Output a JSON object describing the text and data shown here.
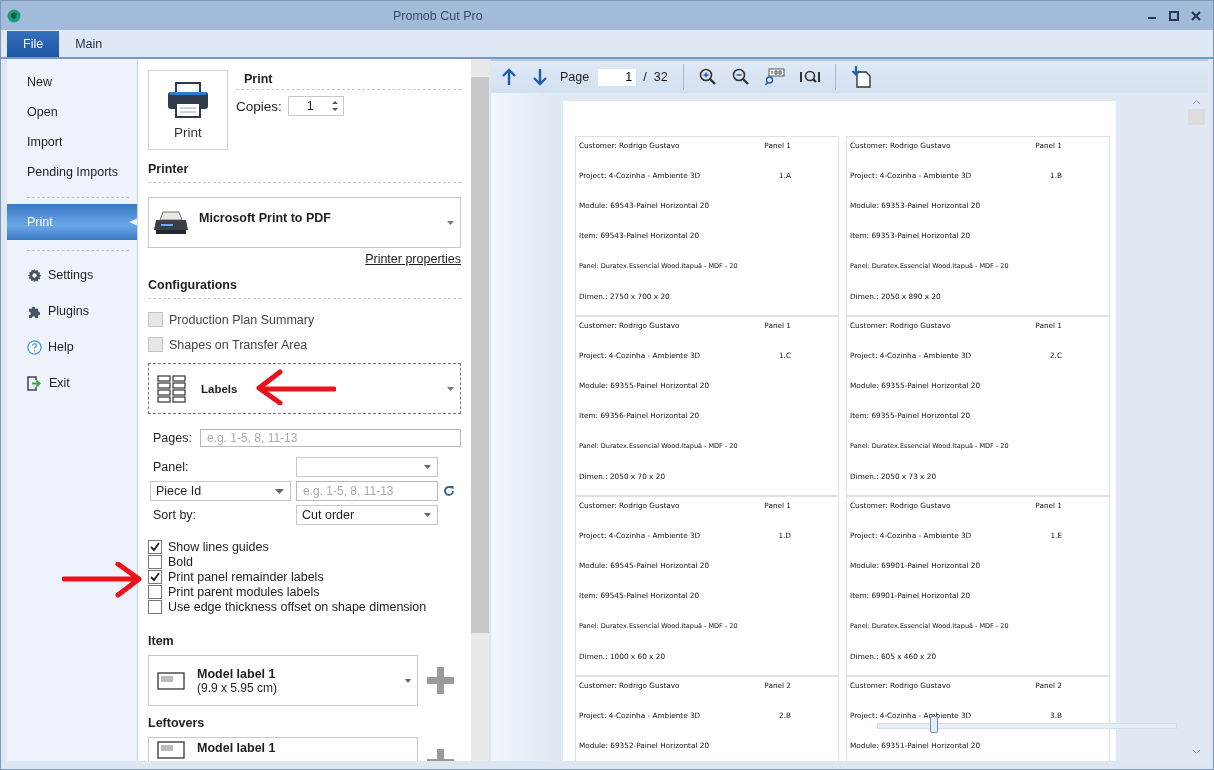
{
  "window": {
    "title": "Promob Cut Pro"
  },
  "tabs": [
    {
      "label": "File",
      "selected": true
    },
    {
      "label": "Main",
      "selected": false
    }
  ],
  "nav": {
    "items": [
      {
        "label": "New",
        "selected": false
      },
      {
        "label": "Open",
        "selected": false
      },
      {
        "label": "Import",
        "selected": false
      },
      {
        "label": "Pending Imports",
        "selected": false
      },
      {
        "label": "Print",
        "selected": true
      },
      {
        "label": "Settings",
        "selected": false
      },
      {
        "label": "Plugins",
        "selected": false
      },
      {
        "label": "Help",
        "selected": false
      },
      {
        "label": "Exit",
        "selected": false
      }
    ]
  },
  "print": {
    "button": "Print",
    "heading": "Print",
    "copies_label": "Copies:",
    "copies": "1"
  },
  "printer": {
    "heading": "Printer",
    "name": "Microsoft Print to PDF",
    "link": "Printer properties"
  },
  "configurations": {
    "heading": "Configurations",
    "options": [
      {
        "label": "Production Plan Summary",
        "checked": false,
        "disabled": true
      },
      {
        "label": "Shapes on Transfer Area",
        "checked": false,
        "disabled": true
      }
    ],
    "report": "Labels",
    "pages_label": "Pages:",
    "pages_placeholder": "e.g. 1-5, 8, 11-13",
    "panel_label": "Panel:",
    "filter": "Piece Id",
    "filter_placeholder": "e.g. 1-5, 8, 11-13",
    "sort_label": "Sort by:",
    "sort": "Cut order",
    "checks": [
      {
        "label": "Show lines guides",
        "checked": true
      },
      {
        "label": "Bold",
        "checked": false
      },
      {
        "label": "Print panel remainder labels",
        "checked": true
      },
      {
        "label": "Print parent modules labels",
        "checked": false
      },
      {
        "label": "Use edge thickness offset on shape dimension",
        "checked": false
      }
    ]
  },
  "item": {
    "heading": "Item",
    "model": "Model label 1",
    "size": "(9.9 x 5.95 cm)"
  },
  "leftovers": {
    "heading": "Leftovers",
    "model": "Model label 1"
  },
  "preview": {
    "page_label": "Page",
    "page": "1",
    "separator": "/",
    "total": "32",
    "zoom": {
      "level": 0.19
    },
    "labels": [
      {
        "customer": "Customer: Rodrigo Gustavo",
        "panel": "Panel 1",
        "project": "Project: 4-Cozinha - Ambiente 3D",
        "code": "1.A",
        "module": "Module: 69543-Painel Horizontal 20",
        "item": "Item: 69543-Painel Horizontal 20",
        "material": "Panel: Duratex.Essencial Wood.Itapuã - MDF - 20",
        "dimensions": "Dimen.: 2750 x 700 x 20"
      },
      {
        "customer": "Customer: Rodrigo Gustavo",
        "panel": "Panel 1",
        "project": "Project: 4-Cozinha - Ambiente 3D",
        "code": "1.B",
        "module": "Module: 69353-Painel Horizontal 20",
        "item": "Item: 69353-Painel Horizontal 20",
        "material": "Panel: Duratex.Essencial Wood.Itapuã - MDF - 20",
        "dimensions": "Dimen.: 2050 x 890 x 20"
      },
      {
        "customer": "Customer: Rodrigo Gustavo",
        "panel": "Panel 1",
        "project": "Project: 4-Cozinha - Ambiente 3D",
        "code": "1.C",
        "module": "Module: 69355-Painel Horizontal 20",
        "item": "Item: 69356-Painel Horizontal 20",
        "material": "Panel: Duratex.Essencial Wood.Itapuã - MDF - 20",
        "dimensions": "Dimen.: 2050 x 70 x 20"
      },
      {
        "customer": "Customer: Rodrigo Gustavo",
        "panel": "Panel 1",
        "project": "Project: 4-Cozinha - Ambiente 3D",
        "code": "2.C",
        "module": "Module: 69355-Painel Horizontal 20",
        "item": "Item: 69355-Painel Horizontal 20",
        "material": "Panel: Duratex.Essencial Wood.Itapuã - MDF - 20",
        "dimensions": "Dimen.: 2050 x 73 x 20"
      },
      {
        "customer": "Customer: Rodrigo Gustavo",
        "panel": "Panel 1",
        "project": "Project: 4-Cozinha - Ambiente 3D",
        "code": "1.D",
        "module": "Module: 69545-Painel Horizontal 20",
        "item": "Item: 69545-Painel Horizontal 20",
        "material": "Panel: Duratex.Essencial Wood.Itapuã - MDF - 20",
        "dimensions": "Dimen.: 1000 x 60 x 20"
      },
      {
        "customer": "Customer: Rodrigo Gustavo",
        "panel": "Panel 1",
        "project": "Project: 4-Cozinha - Ambiente 3D",
        "code": "1.E",
        "module": "Module: 69901-Painel Horizontal 20",
        "item": "Item: 69901-Painel Horizontal 20",
        "material": "Panel: Duratex.Essencial Wood.Itapuã - MDF - 20",
        "dimensions": "Dimen.: 605 x 460 x 20"
      },
      {
        "customer": "Customer: Rodrigo Gustavo",
        "panel": "Panel 2",
        "project": "Project: 4-Cozinha - Ambiente 3D",
        "code": "2.B",
        "module": "Module: 69352-Painel Horizontal 20"
      },
      {
        "customer": "Customer: Rodrigo Gustavo",
        "panel": "Panel 2",
        "project": "Project: 4-Cozinha - Ambiente 3D",
        "code": "3.B",
        "module": "Module: 69351-Painel Horizontal 20"
      }
    ]
  }
}
